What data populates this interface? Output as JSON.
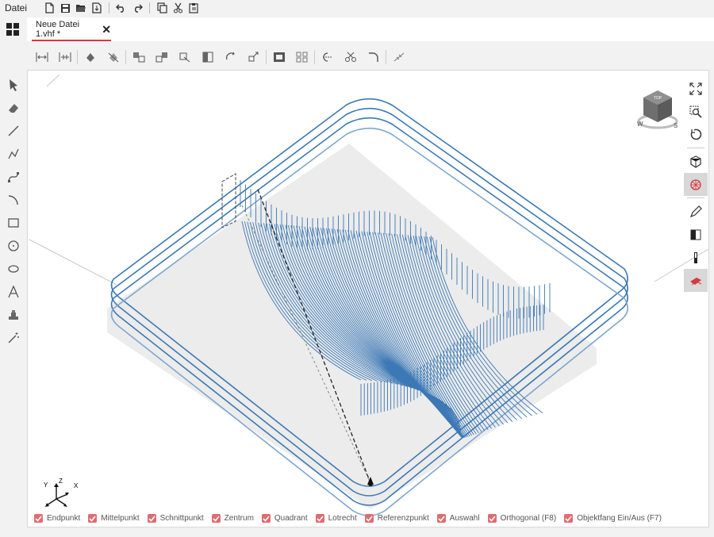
{
  "menu": {
    "file": "Datei"
  },
  "quick_access": [
    "new-file-icon",
    "save-icon",
    "open-folder-icon",
    "export-icon",
    "undo-icon",
    "redo-icon",
    "copy-icon",
    "cut-icon",
    "paste-icon"
  ],
  "tab": {
    "title": "Neue Datei 1.vhf *",
    "close": "✕"
  },
  "ribbon_icons": [
    "align-horizontal-icon",
    "align-vertical-icon",
    "fill-icon",
    "clear-fill-icon",
    "group-icon",
    "ungroup-icon",
    "transform-icon",
    "mirror-icon",
    "rotate-icon",
    "scale-icon",
    "frame-icon",
    "array-icon",
    "trim-icon",
    "cut-scissors-icon",
    "fillet-icon",
    "measure-icon"
  ],
  "left_tools": [
    "select-arrow-icon",
    "eraser-icon",
    "line-icon",
    "polyline-icon",
    "bezier-icon",
    "arc-icon",
    "rectangle-icon",
    "circle-icon",
    "ellipse-icon",
    "text-icon",
    "bitmap-icon",
    "magic-wand-icon"
  ],
  "right_tools": [
    "fit-view-icon",
    "zoom-window-icon",
    "rotate-view-icon",
    "cube-view-icon",
    "sphere-view-icon",
    "pen-icon",
    "material-icon",
    "tool-icon",
    "simulation-icon"
  ],
  "navcube": {
    "top": "TOP",
    "left": "W",
    "right": "S"
  },
  "axes": {
    "x": "X",
    "y": "Y",
    "z": "Z"
  },
  "snap_options": [
    {
      "label": "Endpunkt",
      "checked": true
    },
    {
      "label": "Mittelpunkt",
      "checked": true
    },
    {
      "label": "Schnittpunkt",
      "checked": true
    },
    {
      "label": "Zentrum",
      "checked": true
    },
    {
      "label": "Quadrant",
      "checked": true
    },
    {
      "label": "Lotrecht",
      "checked": true
    },
    {
      "label": "Referenzpunkt",
      "checked": true
    },
    {
      "label": "Auswahl",
      "checked": true
    },
    {
      "label": "Orthogonal (F8)",
      "checked": true
    },
    {
      "label": "Objektfang Ein/Aus (F7)",
      "checked": true
    }
  ],
  "colors": {
    "accent": "#d9363e",
    "toolpath": "#3b78b5",
    "checkbox": "#e06c70"
  }
}
